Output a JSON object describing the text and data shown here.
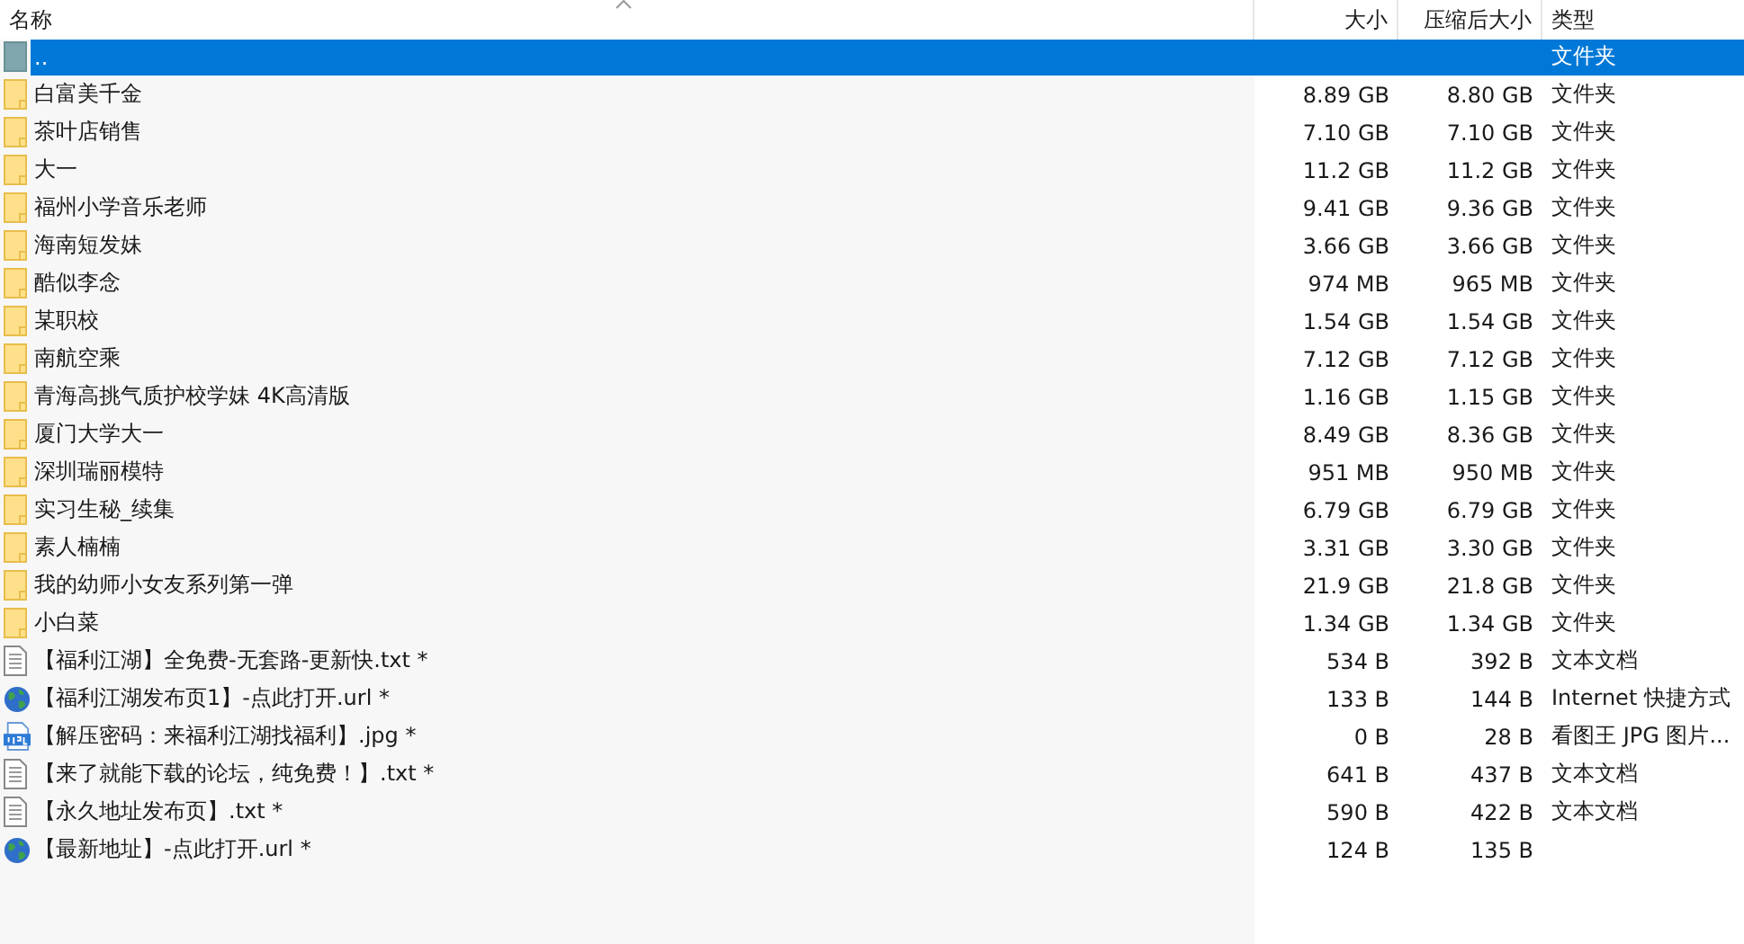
{
  "columns": [
    "名称",
    "大小",
    "压缩后大小",
    "类型"
  ],
  "rows": [
    {
      "kind": "parent",
      "name": "..",
      "size": "",
      "packed": "",
      "type": "文件夹",
      "selected": true
    },
    {
      "kind": "folder",
      "name": "白富美千金",
      "size": "8.89 GB",
      "packed": "8.80 GB",
      "type": "文件夹",
      "selected": false
    },
    {
      "kind": "folder",
      "name": "茶叶店销售",
      "size": "7.10 GB",
      "packed": "7.10 GB",
      "type": "文件夹",
      "selected": false
    },
    {
      "kind": "folder",
      "name": "大一",
      "size": "11.2 GB",
      "packed": "11.2 GB",
      "type": "文件夹",
      "selected": false
    },
    {
      "kind": "folder",
      "name": "福州小学音乐老师",
      "size": "9.41 GB",
      "packed": "9.36 GB",
      "type": "文件夹",
      "selected": false
    },
    {
      "kind": "folder",
      "name": "海南短发妹",
      "size": "3.66 GB",
      "packed": "3.66 GB",
      "type": "文件夹",
      "selected": false
    },
    {
      "kind": "folder",
      "name": "酷似李念",
      "size": "974 MB",
      "packed": "965 MB",
      "type": "文件夹",
      "selected": false
    },
    {
      "kind": "folder",
      "name": "某职校",
      "size": "1.54 GB",
      "packed": "1.54 GB",
      "type": "文件夹",
      "selected": false
    },
    {
      "kind": "folder",
      "name": "南航空乘",
      "size": "7.12 GB",
      "packed": "7.12 GB",
      "type": "文件夹",
      "selected": false
    },
    {
      "kind": "folder",
      "name": "青海高挑气质护校学妹 4K高清版",
      "size": "1.16 GB",
      "packed": "1.15 GB",
      "type": "文件夹",
      "selected": false
    },
    {
      "kind": "folder",
      "name": "厦门大学大一",
      "size": "8.49 GB",
      "packed": "8.36 GB",
      "type": "文件夹",
      "selected": false
    },
    {
      "kind": "folder",
      "name": "深圳瑞丽模特",
      "size": "951 MB",
      "packed": "950 MB",
      "type": "文件夹",
      "selected": false
    },
    {
      "kind": "folder",
      "name": "实习生秘_续集",
      "size": "6.79 GB",
      "packed": "6.79 GB",
      "type": "文件夹",
      "selected": false
    },
    {
      "kind": "folder",
      "name": "素人楠楠",
      "size": "3.31 GB",
      "packed": "3.30 GB",
      "type": "文件夹",
      "selected": false
    },
    {
      "kind": "folder",
      "name": "我的幼师小女友系列第一弹",
      "size": "21.9 GB",
      "packed": "21.8 GB",
      "type": "文件夹",
      "selected": false
    },
    {
      "kind": "folder",
      "name": "小白菜",
      "size": "1.34 GB",
      "packed": "1.34 GB",
      "type": "文件夹",
      "selected": false
    },
    {
      "kind": "text",
      "name": "【福利江湖】全免费-无套路-更新快.txt *",
      "size": "534 B",
      "packed": "392 B",
      "type": "文本文档",
      "selected": false
    },
    {
      "kind": "url",
      "name": "【福利江湖发布页1】-点此打开.url *",
      "size": "133 B",
      "packed": "144 B",
      "type": "Internet 快捷方式",
      "selected": false
    },
    {
      "kind": "image",
      "name": "【解压密码：来福利江湖找福利】.jpg *",
      "size": "0 B",
      "packed": "28 B",
      "type": "看图王 JPG 图片...",
      "selected": false
    },
    {
      "kind": "text",
      "name": "【来了就能下载的论坛，纯免费！】.txt *",
      "size": "641 B",
      "packed": "437 B",
      "type": "文本文档",
      "selected": false
    },
    {
      "kind": "text",
      "name": "【永久地址发布页】.txt *",
      "size": "590 B",
      "packed": "422 B",
      "type": "文本文档",
      "selected": false
    },
    {
      "kind": "url",
      "name": "【最新地址】-点此打开.url *",
      "size": "124 B",
      "packed": "135 B",
      "type": "",
      "selected": false
    }
  ]
}
